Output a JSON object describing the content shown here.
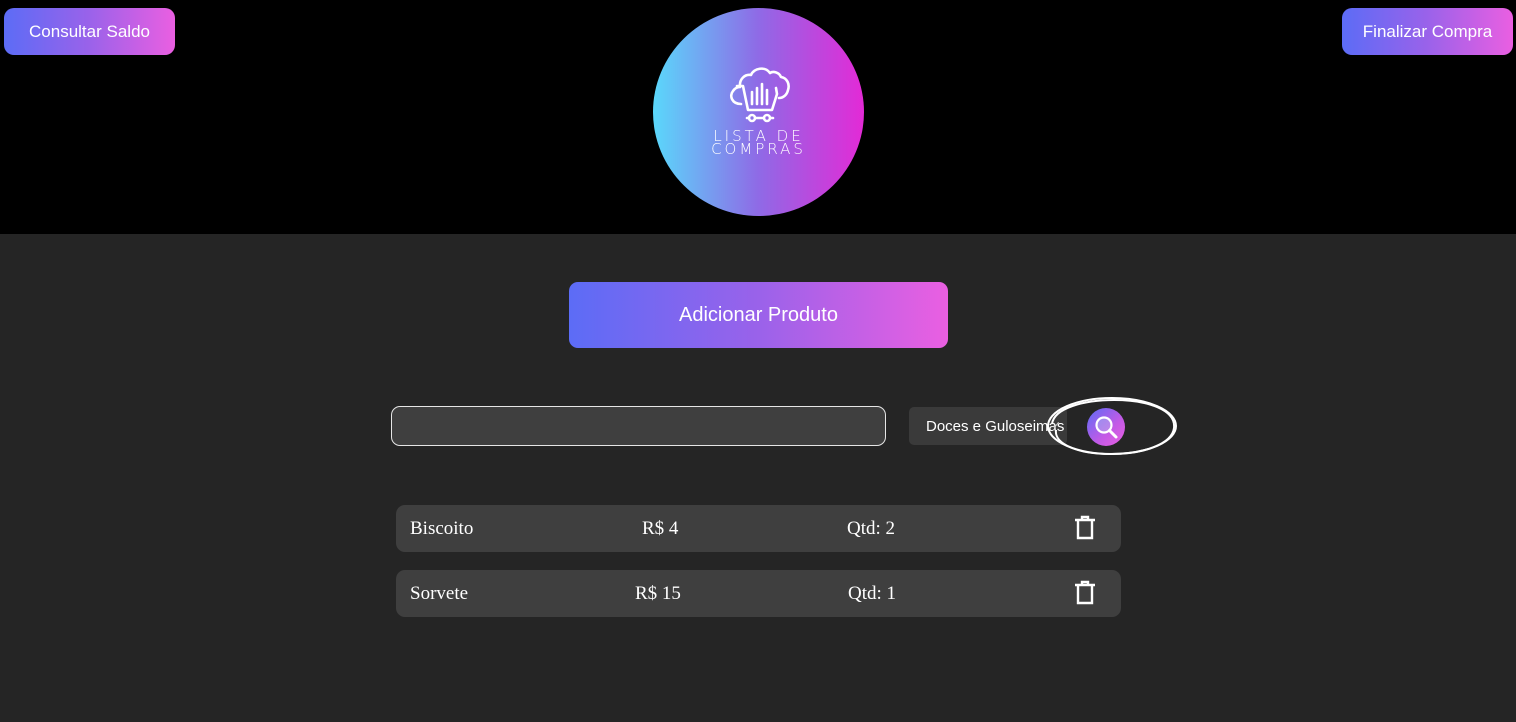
{
  "header": {
    "saldo_label": "Consultar Saldo",
    "finalizar_label": "Finalizar Compra",
    "logo_line1": "LISTA DE",
    "logo_line2": "COMPRAS"
  },
  "main": {
    "add_label": "Adicionar Produto",
    "search": {
      "value": "",
      "placeholder": ""
    },
    "category_selected": "Doces e Guloseimas"
  },
  "items": [
    {
      "name": "Biscoito",
      "price": "R$ 4",
      "qty": "Qtd: 2"
    },
    {
      "name": "Sorvete",
      "price": "R$ 15",
      "qty": "Qtd: 1"
    }
  ],
  "colors": {
    "gradient_start": "#5c6cf6",
    "gradient_end": "#ea5fe1",
    "header_bg": "#000000",
    "body_bg": "#252525",
    "row_bg": "#3f3f3f"
  },
  "icons": {
    "logo": "cloud-cart-icon",
    "search": "magnifier-icon",
    "delete": "trash-icon"
  }
}
